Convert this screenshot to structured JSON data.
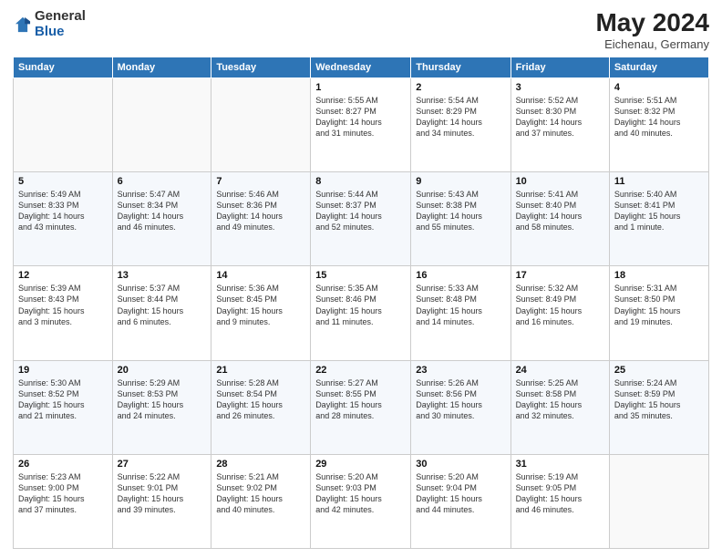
{
  "header": {
    "logo_general": "General",
    "logo_blue": "Blue",
    "month_year": "May 2024",
    "location": "Eichenau, Germany"
  },
  "days_of_week": [
    "Sunday",
    "Monday",
    "Tuesday",
    "Wednesday",
    "Thursday",
    "Friday",
    "Saturday"
  ],
  "weeks": [
    [
      {
        "day": "",
        "info": ""
      },
      {
        "day": "",
        "info": ""
      },
      {
        "day": "",
        "info": ""
      },
      {
        "day": "1",
        "info": "Sunrise: 5:55 AM\nSunset: 8:27 PM\nDaylight: 14 hours\nand 31 minutes."
      },
      {
        "day": "2",
        "info": "Sunrise: 5:54 AM\nSunset: 8:29 PM\nDaylight: 14 hours\nand 34 minutes."
      },
      {
        "day": "3",
        "info": "Sunrise: 5:52 AM\nSunset: 8:30 PM\nDaylight: 14 hours\nand 37 minutes."
      },
      {
        "day": "4",
        "info": "Sunrise: 5:51 AM\nSunset: 8:32 PM\nDaylight: 14 hours\nand 40 minutes."
      }
    ],
    [
      {
        "day": "5",
        "info": "Sunrise: 5:49 AM\nSunset: 8:33 PM\nDaylight: 14 hours\nand 43 minutes."
      },
      {
        "day": "6",
        "info": "Sunrise: 5:47 AM\nSunset: 8:34 PM\nDaylight: 14 hours\nand 46 minutes."
      },
      {
        "day": "7",
        "info": "Sunrise: 5:46 AM\nSunset: 8:36 PM\nDaylight: 14 hours\nand 49 minutes."
      },
      {
        "day": "8",
        "info": "Sunrise: 5:44 AM\nSunset: 8:37 PM\nDaylight: 14 hours\nand 52 minutes."
      },
      {
        "day": "9",
        "info": "Sunrise: 5:43 AM\nSunset: 8:38 PM\nDaylight: 14 hours\nand 55 minutes."
      },
      {
        "day": "10",
        "info": "Sunrise: 5:41 AM\nSunset: 8:40 PM\nDaylight: 14 hours\nand 58 minutes."
      },
      {
        "day": "11",
        "info": "Sunrise: 5:40 AM\nSunset: 8:41 PM\nDaylight: 15 hours\nand 1 minute."
      }
    ],
    [
      {
        "day": "12",
        "info": "Sunrise: 5:39 AM\nSunset: 8:43 PM\nDaylight: 15 hours\nand 3 minutes."
      },
      {
        "day": "13",
        "info": "Sunrise: 5:37 AM\nSunset: 8:44 PM\nDaylight: 15 hours\nand 6 minutes."
      },
      {
        "day": "14",
        "info": "Sunrise: 5:36 AM\nSunset: 8:45 PM\nDaylight: 15 hours\nand 9 minutes."
      },
      {
        "day": "15",
        "info": "Sunrise: 5:35 AM\nSunset: 8:46 PM\nDaylight: 15 hours\nand 11 minutes."
      },
      {
        "day": "16",
        "info": "Sunrise: 5:33 AM\nSunset: 8:48 PM\nDaylight: 15 hours\nand 14 minutes."
      },
      {
        "day": "17",
        "info": "Sunrise: 5:32 AM\nSunset: 8:49 PM\nDaylight: 15 hours\nand 16 minutes."
      },
      {
        "day": "18",
        "info": "Sunrise: 5:31 AM\nSunset: 8:50 PM\nDaylight: 15 hours\nand 19 minutes."
      }
    ],
    [
      {
        "day": "19",
        "info": "Sunrise: 5:30 AM\nSunset: 8:52 PM\nDaylight: 15 hours\nand 21 minutes."
      },
      {
        "day": "20",
        "info": "Sunrise: 5:29 AM\nSunset: 8:53 PM\nDaylight: 15 hours\nand 24 minutes."
      },
      {
        "day": "21",
        "info": "Sunrise: 5:28 AM\nSunset: 8:54 PM\nDaylight: 15 hours\nand 26 minutes."
      },
      {
        "day": "22",
        "info": "Sunrise: 5:27 AM\nSunset: 8:55 PM\nDaylight: 15 hours\nand 28 minutes."
      },
      {
        "day": "23",
        "info": "Sunrise: 5:26 AM\nSunset: 8:56 PM\nDaylight: 15 hours\nand 30 minutes."
      },
      {
        "day": "24",
        "info": "Sunrise: 5:25 AM\nSunset: 8:58 PM\nDaylight: 15 hours\nand 32 minutes."
      },
      {
        "day": "25",
        "info": "Sunrise: 5:24 AM\nSunset: 8:59 PM\nDaylight: 15 hours\nand 35 minutes."
      }
    ],
    [
      {
        "day": "26",
        "info": "Sunrise: 5:23 AM\nSunset: 9:00 PM\nDaylight: 15 hours\nand 37 minutes."
      },
      {
        "day": "27",
        "info": "Sunrise: 5:22 AM\nSunset: 9:01 PM\nDaylight: 15 hours\nand 39 minutes."
      },
      {
        "day": "28",
        "info": "Sunrise: 5:21 AM\nSunset: 9:02 PM\nDaylight: 15 hours\nand 40 minutes."
      },
      {
        "day": "29",
        "info": "Sunrise: 5:20 AM\nSunset: 9:03 PM\nDaylight: 15 hours\nand 42 minutes."
      },
      {
        "day": "30",
        "info": "Sunrise: 5:20 AM\nSunset: 9:04 PM\nDaylight: 15 hours\nand 44 minutes."
      },
      {
        "day": "31",
        "info": "Sunrise: 5:19 AM\nSunset: 9:05 PM\nDaylight: 15 hours\nand 46 minutes."
      },
      {
        "day": "",
        "info": ""
      }
    ]
  ]
}
